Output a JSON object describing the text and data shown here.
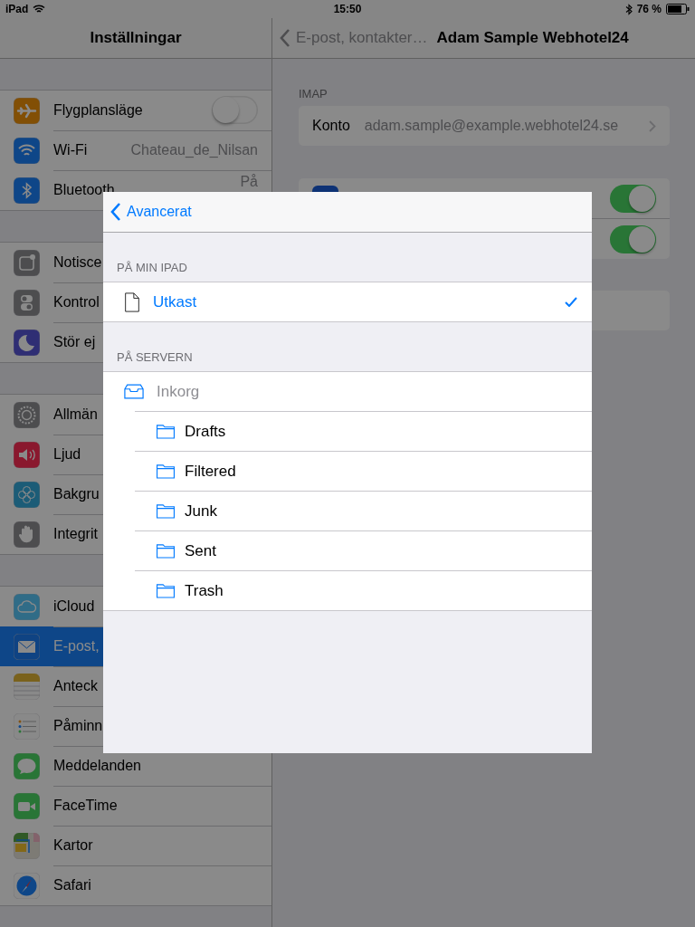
{
  "status_bar": {
    "device": "iPad",
    "time": "15:50",
    "battery": "76 %"
  },
  "sidebar": {
    "title": "Inställningar",
    "groups": [
      {
        "items": [
          {
            "label": "Flygplansläge",
            "kind": "toggle",
            "on": false,
            "selected": false
          },
          {
            "label": "Wi-Fi",
            "kind": "value",
            "value": "Chateau_de_Nilsan",
            "selected": false
          },
          {
            "label": "Bluetooth",
            "kind": "value",
            "value": "På",
            "selected": false
          }
        ]
      },
      {
        "items": [
          {
            "label": "Notisce",
            "kind": "plain",
            "selected": false
          },
          {
            "label": "Kontrol",
            "kind": "plain",
            "selected": false
          },
          {
            "label": "Stör ej",
            "kind": "plain",
            "selected": false
          }
        ]
      },
      {
        "items": [
          {
            "label": "Allmän",
            "kind": "plain",
            "selected": false
          },
          {
            "label": "Ljud",
            "kind": "plain",
            "selected": false
          },
          {
            "label": "Bakgru",
            "kind": "plain",
            "selected": false
          },
          {
            "label": "Integrit",
            "kind": "plain",
            "selected": false
          }
        ]
      },
      {
        "items": [
          {
            "label": "iCloud",
            "kind": "plain",
            "selected": false
          },
          {
            "label": "E-post,",
            "kind": "plain",
            "selected": true
          },
          {
            "label": "Anteck",
            "kind": "plain",
            "selected": false
          },
          {
            "label": "Påminn",
            "kind": "plain",
            "selected": false
          },
          {
            "label": "Meddelanden",
            "kind": "plain",
            "selected": false
          },
          {
            "label": "FaceTime",
            "kind": "plain",
            "selected": false
          },
          {
            "label": "Kartor",
            "kind": "plain",
            "selected": false
          },
          {
            "label": "Safari",
            "kind": "plain",
            "selected": false
          }
        ]
      }
    ]
  },
  "detail": {
    "back": "E-post, kontakter…",
    "title": "Adam Sample Webhotel24",
    "section_header": "IMAP",
    "account": {
      "label": "Konto",
      "value": "adam.sample@example.webhotel24.se"
    },
    "toggles": [
      {
        "on": true
      },
      {
        "on": true
      }
    ]
  },
  "modal": {
    "back": "Avancerat",
    "sections": [
      {
        "header": "PÅ MIN IPAD",
        "rows": [
          {
            "label": "Utkast",
            "kind": "file",
            "selected": true,
            "disabled": false
          }
        ]
      },
      {
        "header": "PÅ SERVERN",
        "rows": [
          {
            "label": "Inkorg",
            "kind": "inbox",
            "selected": false,
            "disabled": true,
            "children": [
              {
                "label": "Drafts",
                "kind": "folder",
                "selected": false,
                "disabled": false
              },
              {
                "label": "Filtered",
                "kind": "folder",
                "selected": false,
                "disabled": false
              },
              {
                "label": "Junk",
                "kind": "folder",
                "selected": false,
                "disabled": false
              },
              {
                "label": "Sent",
                "kind": "folder",
                "selected": false,
                "disabled": false
              },
              {
                "label": "Trash",
                "kind": "folder",
                "selected": false,
                "disabled": false
              }
            ]
          }
        ]
      }
    ]
  }
}
